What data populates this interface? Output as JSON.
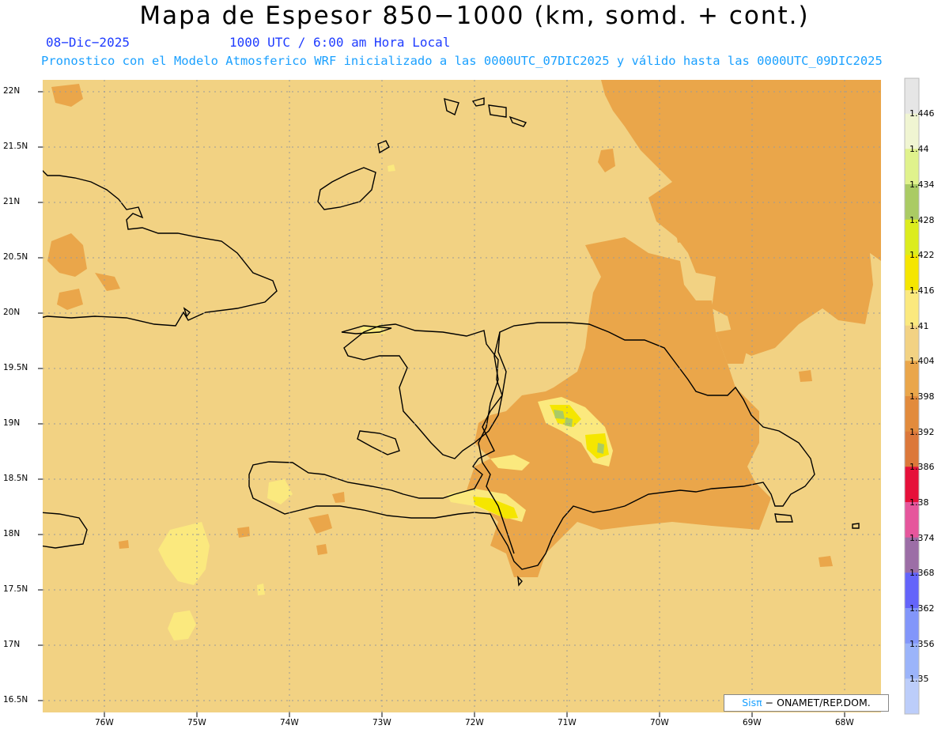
{
  "title": "Mapa de Espesor 850−1000 (km, somd. + cont.)",
  "date": "08−Dic−2025",
  "time": "1000 UTC / 6:00 am Hora Local",
  "forecast_note": "Pronostico con el Modelo Atmosferico WRF inicializado a las 0000UTC_07DIC2025 y válido hasta las  0000UTC_09DIC2025",
  "lat_labels": [
    "22N",
    "21.5N",
    "21N",
    "20.5N",
    "20N",
    "19.5N",
    "19N",
    "18.5N",
    "18N",
    "17.5N",
    "17N",
    "16.5N"
  ],
  "lon_labels": [
    "76W",
    "75W",
    "74W",
    "73W",
    "72W",
    "71W",
    "70W",
    "69W",
    "68W"
  ],
  "colorbar": {
    "labels": [
      "1.446",
      "1.44",
      "1.434",
      "1.428",
      "1.422",
      "1.416",
      "1.41",
      "1.404",
      "1.398",
      "1.392",
      "1.386",
      "1.38",
      "1.374",
      "1.368",
      "1.362",
      "1.356",
      "1.35"
    ],
    "colors": [
      "#e6e6e6",
      "#f0f5d2",
      "#e0f28c",
      "#aacb64",
      "#dcec1e",
      "#f5e600",
      "#fbe97e",
      "#f2d283",
      "#eaa64a",
      "#e28b3c",
      "#dc783a",
      "#e6103a",
      "#e6569c",
      "#9c6ea6",
      "#6464fa",
      "#8296fa",
      "#9bb4fa",
      "#bccdfa"
    ]
  },
  "credit": {
    "logo": "Sisπ",
    "org": " − ONAMET/REP.DOM."
  },
  "colors": {
    "base": "#f2d283",
    "orange": "#eaa64a",
    "yellow": "#fbe97e",
    "bright_yellow": "#f5e600",
    "green": "#aacb64"
  }
}
